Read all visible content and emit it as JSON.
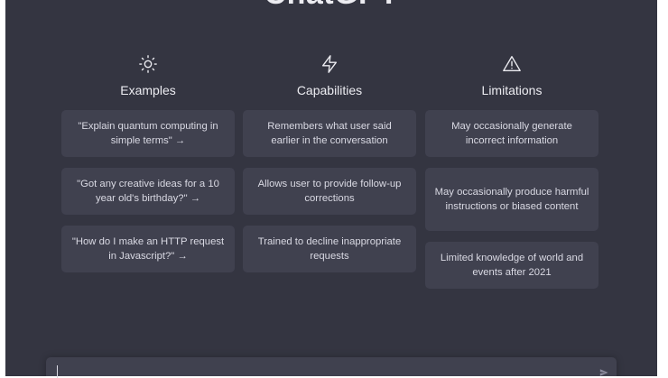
{
  "app": {
    "title": "ChatGPT"
  },
  "columns": [
    {
      "icon": "sun-icon",
      "title": "Examples",
      "cards": [
        "\"Explain quantum computing in simple terms\" →",
        "\"Got any creative ideas for a 10 year old's birthday?\" →",
        "\"How do I make an HTTP request in Javascript?\" →"
      ]
    },
    {
      "icon": "lightning-icon",
      "title": "Capabilities",
      "cards": [
        "Remembers what user said earlier in the conversation",
        "Allows user to provide follow-up corrections",
        "Trained to decline inappropriate requests"
      ]
    },
    {
      "icon": "warning-icon",
      "title": "Limitations",
      "cards": [
        "May occasionally generate incorrect information",
        "May occasionally produce harmful instructions or biased content",
        "Limited knowledge of world and events after 2021"
      ]
    }
  ],
  "composer": {
    "value": "",
    "send_icon": "send-icon"
  },
  "colors": {
    "background": "#343541",
    "card": "#40414f",
    "text": "#ececf1"
  }
}
